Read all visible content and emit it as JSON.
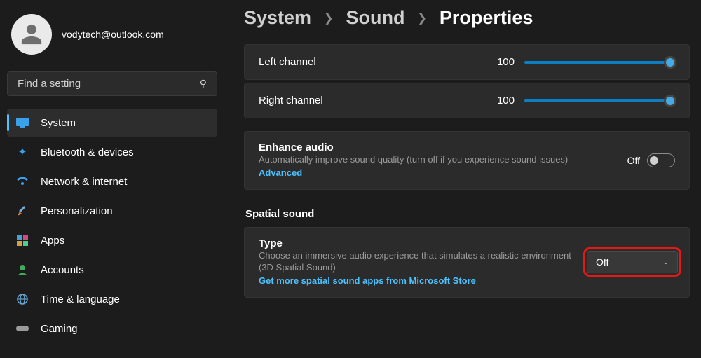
{
  "user": {
    "email": "vodytech@outlook.com"
  },
  "search": {
    "placeholder": "Find a setting"
  },
  "nav": {
    "items": [
      {
        "label": "System"
      },
      {
        "label": "Bluetooth & devices"
      },
      {
        "label": "Network & internet"
      },
      {
        "label": "Personalization"
      },
      {
        "label": "Apps"
      },
      {
        "label": "Accounts"
      },
      {
        "label": "Time & language"
      },
      {
        "label": "Gaming"
      }
    ]
  },
  "breadcrumb": {
    "a": "System",
    "b": "Sound",
    "c": "Properties"
  },
  "channels": {
    "left": {
      "label": "Left channel",
      "value": "100"
    },
    "right": {
      "label": "Right channel",
      "value": "100"
    }
  },
  "enhance": {
    "title": "Enhance audio",
    "desc": "Automatically improve sound quality (turn off if you experience sound issues)",
    "link": "Advanced",
    "state": "Off"
  },
  "spatial": {
    "heading": "Spatial sound",
    "title": "Type",
    "desc": "Choose an immersive audio experience that simulates a realistic environment (3D Spatial Sound)",
    "link": "Get more spatial sound apps from Microsoft Store",
    "value": "Off"
  }
}
